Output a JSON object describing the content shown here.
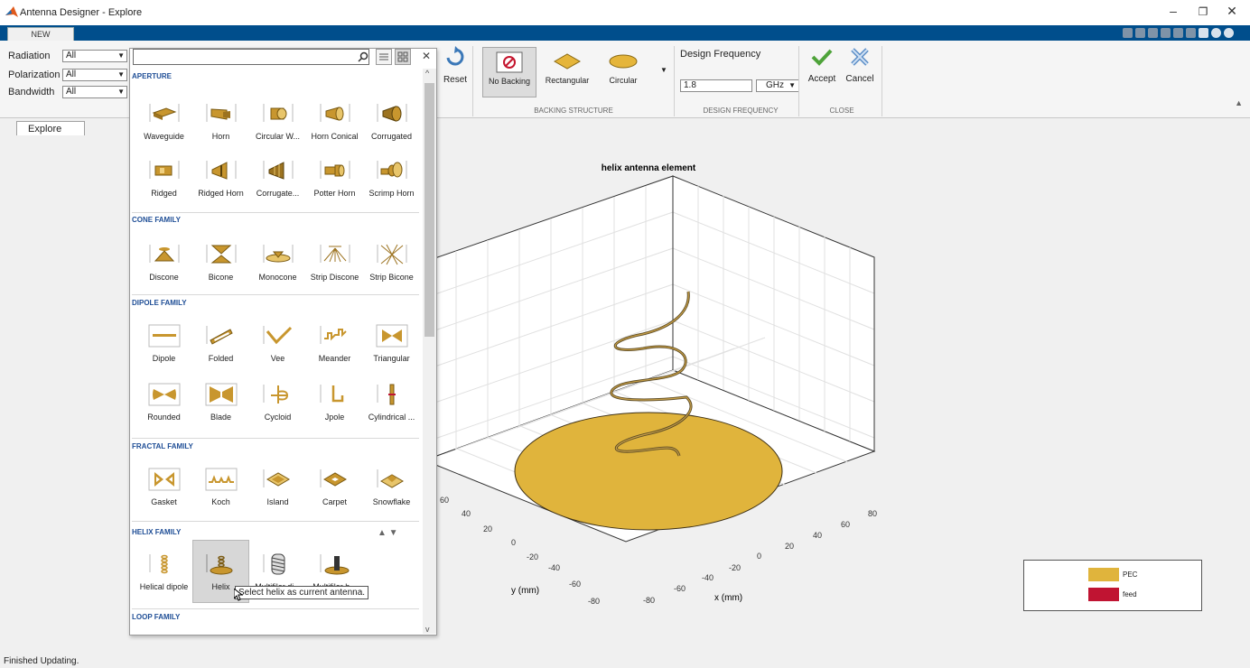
{
  "window": {
    "title": "Antenna Designer - Explore"
  },
  "ribbon": {
    "tab": "NEW",
    "filters": [
      {
        "label": "Radiation",
        "value": "All"
      },
      {
        "label": "Polarization",
        "value": "All"
      },
      {
        "label": "Bandwidth",
        "value": "All"
      }
    ],
    "reset_label": "Reset",
    "backing": {
      "items": [
        "No Backing",
        "Rectangular",
        "Circular"
      ],
      "group_label": "BACKING STRUCTURE"
    },
    "design_frequency": {
      "label": "Design Frequency",
      "value": "1.8",
      "unit": "GHz",
      "group_label": "DESIGN FREQUENCY"
    },
    "close": {
      "accept": "Accept",
      "cancel": "Cancel",
      "group_label": "CLOSE"
    }
  },
  "document_tab": "Explore",
  "gallery": {
    "search_value": "",
    "categories": [
      {
        "title": "APERTURE",
        "items": [
          "Waveguide",
          "Horn",
          "Circular W...",
          "Horn Conical",
          "Corrugated",
          "Ridged",
          "Ridged Horn",
          "Corrugate...",
          "Potter Horn",
          "Scrimp Horn"
        ]
      },
      {
        "title": "CONE FAMILY",
        "items": [
          "Discone",
          "Bicone",
          "Monocone",
          "Strip Discone",
          "Strip Bicone"
        ]
      },
      {
        "title": "DIPOLE FAMILY",
        "items": [
          "Dipole",
          "Folded",
          "Vee",
          "Meander",
          "Triangular",
          "Rounded",
          "Blade",
          "Cycloid",
          "Jpole",
          "Cylindrical ..."
        ]
      },
      {
        "title": "FRACTAL FAMILY",
        "items": [
          "Gasket",
          "Koch",
          "Island",
          "Carpet",
          "Snowflake"
        ]
      },
      {
        "title": "HELIX FAMILY",
        "items": [
          "Helical dipole",
          "Helix",
          "Multifilar di...",
          "Multifilar h..."
        ]
      },
      {
        "title": "LOOP FAMILY",
        "items": []
      }
    ],
    "tooltip": "Select helix as current antenna."
  },
  "plot": {
    "title": "helix antenna element",
    "xlabel": "x (mm)",
    "ylabel": "y (mm)",
    "x_ticks": [
      "-80",
      "-60",
      "-40",
      "-20",
      "0",
      "20",
      "40",
      "60",
      "80"
    ],
    "y_ticks": [
      "-80",
      "-60",
      "-40",
      "-20",
      "0",
      "20",
      "40",
      "60"
    ],
    "legend": [
      {
        "label": "PEC",
        "color": "#e0b43c"
      },
      {
        "label": "feed",
        "color": "#c01432"
      }
    ]
  },
  "status": "Finished Updating."
}
